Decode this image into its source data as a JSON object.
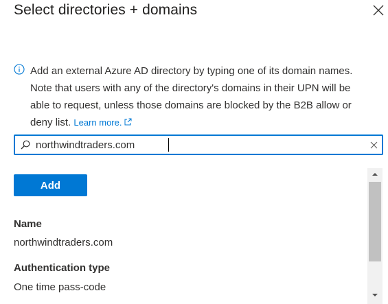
{
  "header": {
    "title": "Select directories + domains",
    "close_icon": "close-icon"
  },
  "info": {
    "icon": "info-icon",
    "text": "Add an external Azure AD directory by typing one of its domain names. Note that users with any of the directory's domains in their UPN will be able to request, unless those domains are blocked by the B2B allow or deny list.",
    "learn_more": "Learn more.",
    "link_icon": "external-link-icon"
  },
  "search": {
    "icon": "search-icon",
    "value": "northwindtraders.com",
    "clear_icon": "clear-icon"
  },
  "actions": {
    "add_label": "Add"
  },
  "details": {
    "name_label": "Name",
    "name_value": "northwindtraders.com",
    "auth_label": "Authentication type",
    "auth_value": "One time pass-code"
  },
  "colors": {
    "accent": "#0078d4",
    "text": "#323130",
    "scroll_track": "#f1f1f1",
    "scroll_thumb": "#c1c1c1"
  }
}
